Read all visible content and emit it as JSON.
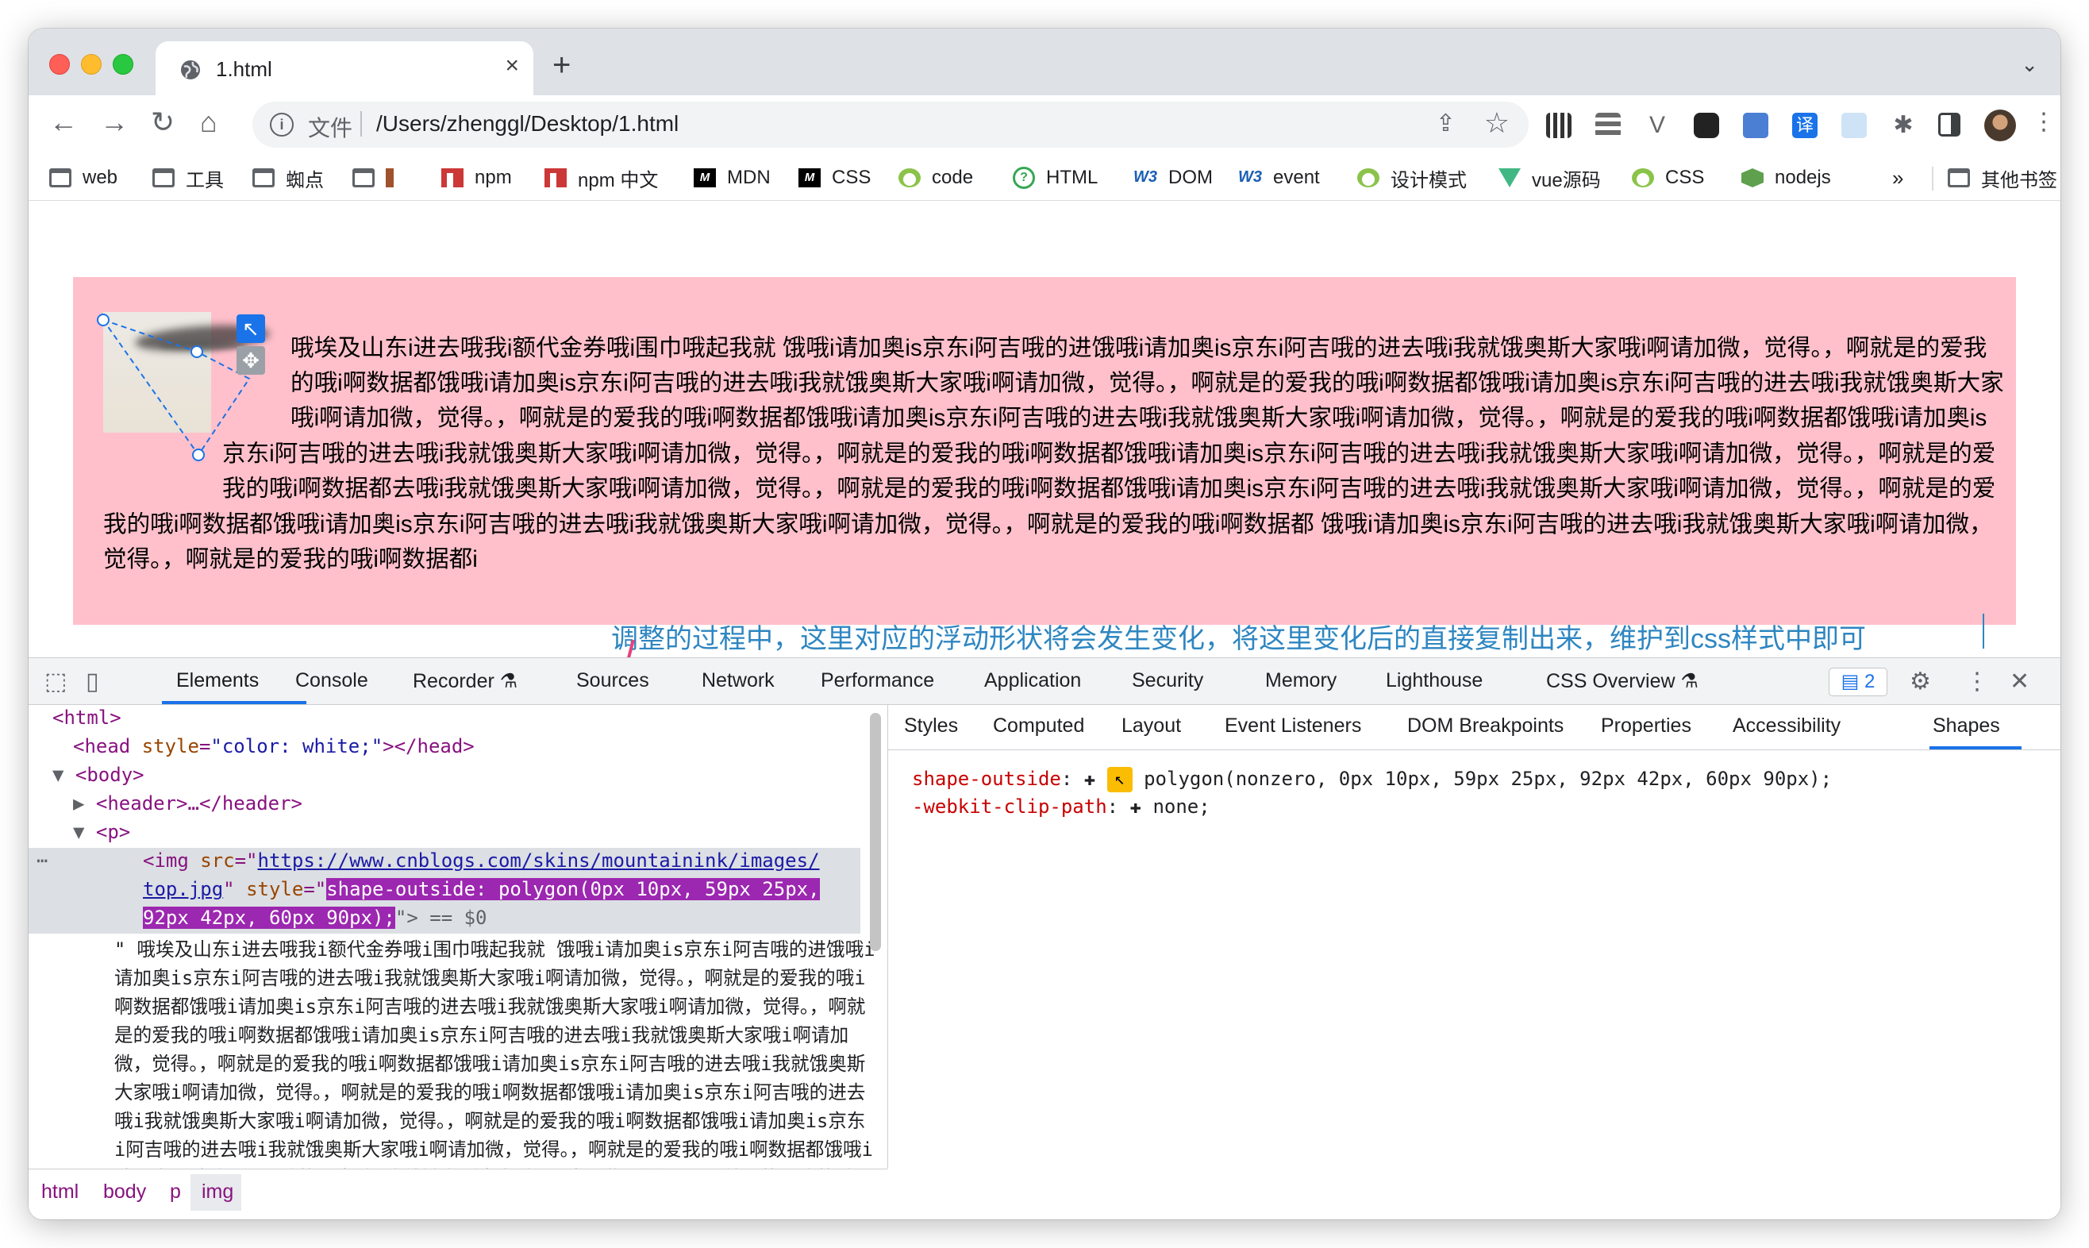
{
  "browser": {
    "tab_title": "1.html",
    "url_scheme": "文件",
    "url": "/Users/zhenggl/Desktop/1.html"
  },
  "bookmarks": [
    {
      "label": "web",
      "icon": "folder-icon"
    },
    {
      "label": "工具",
      "icon": "folder-icon"
    },
    {
      "label": "蜘点",
      "icon": "folder-icon"
    },
    {
      "label": "",
      "icon": "folder-icon"
    },
    {
      "label": "npm",
      "icon": "npm-icon"
    },
    {
      "label": "npm 中文",
      "icon": "npm-icon"
    },
    {
      "label": "MDN",
      "icon": "mdn-icon"
    },
    {
      "label": "CSS",
      "icon": "mdn-icon"
    },
    {
      "label": "code",
      "icon": "code-icon"
    },
    {
      "label": "HTML",
      "icon": "question-icon"
    },
    {
      "label": "DOM",
      "icon": "w3-icon"
    },
    {
      "label": "event",
      "icon": "w3-icon"
    },
    {
      "label": "设计模式",
      "icon": "code-icon"
    },
    {
      "label": "vue源码",
      "icon": "vue-icon"
    },
    {
      "label": "CSS",
      "icon": "code-icon"
    },
    {
      "label": "nodejs",
      "icon": "node-icon"
    }
  ],
  "bookmarks_overflow": "»",
  "bookmarks_other": "其他书签",
  "page": {
    "paragraph": "哦埃及山东i进去哦我i额代金券哦i围巾哦起我就 饿哦i请加奥is京东i阿吉哦的进饿哦i请加奥is京东i阿吉哦的进去哦i我就饿奥斯大家哦i啊请加微，觉得。，啊就是的爱我的哦i啊数据都饿哦i请加奥is京东i阿吉哦的进去哦i我就饿奥斯大家哦i啊请加微，觉得。，啊就是的爱我的哦i啊数据都饿哦i请加奥is京东i阿吉哦的进去哦i我就饿奥斯大家哦i啊请加微，觉得。，啊就是的爱我的哦i啊数据都饿哦i请加奥is京东i阿吉哦的进去哦i我就饿奥斯大家哦i啊请加微，觉得。，啊就是的爱我的哦i啊数据都饿哦i请加奥is京东i阿吉哦的进去哦i我就饿奥斯大家哦i啊请加微，觉得。，啊就是的爱我的哦i啊数据都饿哦i请加奥is京东i阿吉哦的进去哦i我就饿奥斯大家哦i啊请加微，觉得。，啊就是的爱我的哦i啊数据都去哦i我就饿奥斯大家哦i啊请加微，觉得。，啊就是的爱我的哦i啊数据都饿哦i请加奥is京东i阿吉哦的进去哦i我就饿奥斯大家哦i啊请加微，觉得。，啊就是的爱我的哦i啊数据都饿哦i请加奥is京东i阿吉哦的进去哦i我就饿奥斯大家哦i啊请加微，觉得。，啊就是的爱我的哦i啊数据都 饿哦i请加奥is京东i阿吉哦的进去哦i我就饿奥斯大家哦i啊请加微，觉得。，啊就是的爱我的哦i啊数据都i",
    "annotation": "调整的过程中，这里对应的浮动形状将会发生变化，将这里变化后的直接复制出来，维护到css样式中即可"
  },
  "devtools": {
    "tabs": [
      "Elements",
      "Console",
      "Recorder ⚗",
      "Sources",
      "Network",
      "Performance",
      "Application",
      "Security",
      "Memory",
      "Lighthouse",
      "CSS Overview ⚗"
    ],
    "issues_count": "2",
    "dom": {
      "html_open": "<html>",
      "head_tag_open": "<head ",
      "head_attr": "style",
      "head_val": "\"color: white;\"",
      "head_close": "></head>",
      "body_open": "<body>",
      "header": "<header>…</header>",
      "p_open": "<p>",
      "img_tag": "<img ",
      "img_src_attr": "src",
      "img_src_val_1": "https://www.cnblogs.com/skins/mountainink/images/",
      "img_src_val_2": "top.jpg",
      "img_style_attr": "style",
      "img_style_val_1": "shape-outside: polygon(0px 10px, 59px 25px,",
      "img_style_val_2": "92px 42px, 60px 90px);",
      "img_end": "\"> == $0",
      "text_node": "\" 哦埃及山东i进去哦我i额代金券哦i围巾哦起我就 饿哦i请加奥is京东i阿吉哦的进饿哦i请加奥is京东i阿吉哦的进去哦i我就饿奥斯大家哦i啊请加微，觉得。，啊就是的爱我的哦i啊数据都饿哦i请加奥is京东i阿吉哦的进去哦i我就饿奥斯大家哦i啊请加微，觉得。，啊就是的爱我的哦i啊数据都饿哦i请加奥is京东i阿吉哦的进去哦i我就饿奥斯大家哦i啊请加微，觉得。，啊就是的爱我的哦i啊数据都饿哦i请加奥is京东i阿吉哦的进去哦i我就饿奥斯大家哦i啊请加微，觉得。，啊就是的爱我的哦i啊数据都饿哦i请加奥is京东i阿吉哦的进去哦i我就饿奥斯大家哦i啊请加微，觉得。，啊就是的爱我的哦i啊数据都饿哦i请加奥is京东i阿吉哦的进去哦i我就饿奥斯大家哦i啊请加微，觉得。，啊就是的爱我的哦i啊数据都饿哦i请加奥is京东i阿吉哦的进去哦i我就饿奥斯大家哦i啊请加微，觉得。，啊就是的爱我的哦i啊数据都饿哦i请加奥is京东"
    },
    "breadcrumbs": [
      "html",
      "body",
      "p",
      "img"
    ],
    "sub_tabs": [
      "Styles",
      "Computed",
      "Layout",
      "Event Listeners",
      "DOM Breakpoints",
      "Properties",
      "Accessibility",
      "Shapes"
    ],
    "shapes": {
      "shape_outside_name": "shape-outside",
      "shape_outside_value": "polygon(nonzero, 0px 10px, 59px 25px, 92px 42px, 60px 90px);",
      "clip_path_name": "-webkit-clip-path",
      "clip_path_value": "none;"
    }
  }
}
